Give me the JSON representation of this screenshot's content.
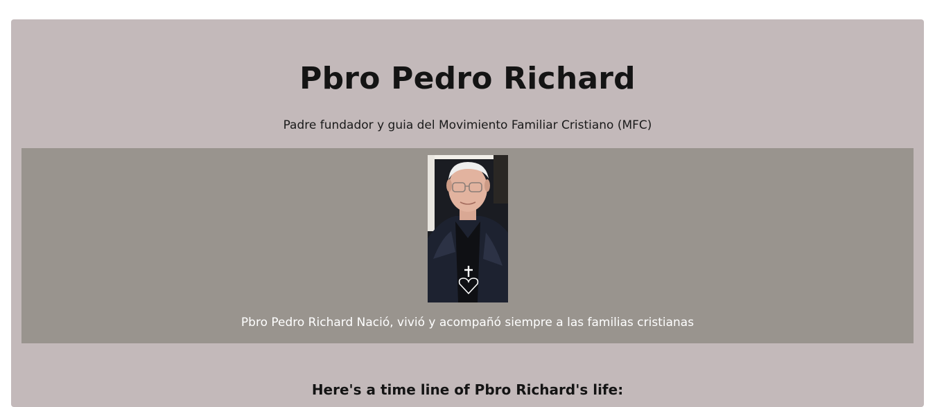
{
  "page": {
    "title": "Pbro Pedro Richard",
    "subtitle": "Padre fundador y guia del Movimiento Familiar Cristiano (MFC)",
    "image": {
      "alt": "Pbro Pedro Richard",
      "caption": "Pbro Pedro Richard Nació, vivió y acompañó siempre a las familias cristianas"
    },
    "timeline_heading": "Here's a time line of Pbro Richard's life:"
  },
  "colors": {
    "page_background": "#ffffff",
    "main_background": "#c3b9ba",
    "image_panel_background": "#99948e",
    "title_text": "#141414",
    "caption_text": "#ffffff"
  }
}
